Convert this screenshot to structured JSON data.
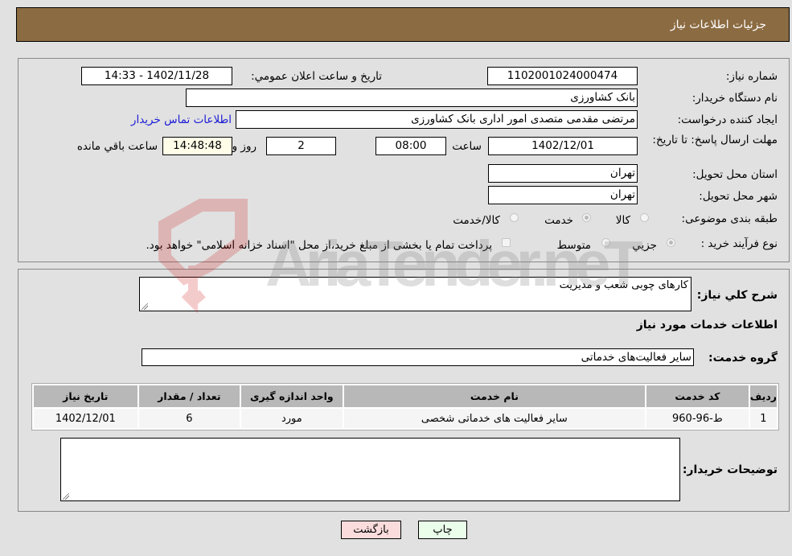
{
  "header": {
    "title": "جزئیات اطلاعات نیاز"
  },
  "form": {
    "need_number_label": "شماره نیاز:",
    "need_number": "1102001024000474",
    "announce_label": "تاریخ و ساعت اعلان عمومي:",
    "announce_value": "1402/11/28 - 14:33",
    "buyer_org_label": "نام دستگاه خریدار:",
    "buyer_org": "بانک کشاورزی",
    "creator_label": "ایجاد کننده درخواست:",
    "creator": "مرتضی مقدمی متصدی امور اداری بانک کشاورزی",
    "contact_link": "اطلاعات تماس خریدار",
    "deadline_label": "مهلت ارسال پاسخ: تا تاریخ:",
    "deadline_date": "1402/12/01",
    "time_label": "ساعت",
    "deadline_time": "08:00",
    "days_value": "2",
    "days_label": "روز و",
    "remaining_time": "14:48:48",
    "remaining_label": "ساعت باقي مانده",
    "province_label": "استان محل تحویل:",
    "province": "تهران",
    "city_label": "شهر محل تحویل:",
    "city": "تهران",
    "category_label": "طبقه بندی موضوعی:",
    "category_options": [
      {
        "label": "کالا",
        "selected": false
      },
      {
        "label": "خدمت",
        "selected": true
      },
      {
        "label": "کالا/خدمت",
        "selected": false
      }
    ],
    "process_label": "نوع فرآیند خرید :",
    "process_options": [
      {
        "label": "جزيي",
        "selected": true
      },
      {
        "label": "متوسط",
        "selected": false
      }
    ],
    "payment_note": "پرداخت تمام یا بخشی از مبلغ خرید،از محل \"اسناد خزانه اسلامی\" خواهد بود."
  },
  "details": {
    "summary_label": "شرح کلي نیاز:",
    "summary": "کارهای چوبی شعب و مدیریت",
    "services_title": "اطلاعات خدمات مورد نیاز",
    "service_group_label": "گروه خدمت:",
    "service_group": "سایر فعالیت‌های خدماتی",
    "table": {
      "headers": [
        "ردیف",
        "کد خدمت",
        "نام خدمت",
        "واحد اندازه گیری",
        "تعداد / مقدار",
        "تاریخ نیاز"
      ],
      "rows": [
        [
          "1",
          "ط-96-960",
          "سایر فعالیت های خدماتی شخصی",
          "مورد",
          "6",
          "1402/12/01"
        ]
      ]
    },
    "buyer_notes_label": "توضیحات خریدار:",
    "buyer_notes": ""
  },
  "buttons": {
    "print": "چاپ",
    "back": "بازگشت"
  },
  "watermark": {
    "text": "AriaTender.neT"
  },
  "colors": {
    "header": "#8b6b42",
    "back_btn": "#fbdcdc",
    "print_btn": "#eafeea"
  }
}
